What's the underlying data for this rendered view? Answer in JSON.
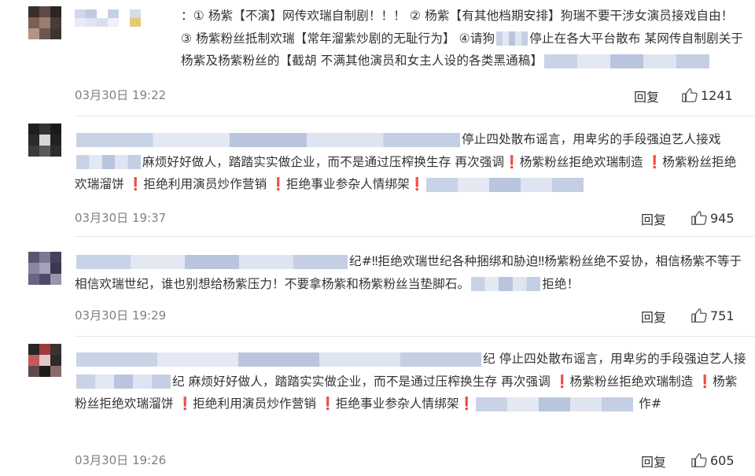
{
  "comments": [
    {
      "text_segments": [
        "：① 杨紫【不演】网传欢瑞自制剧！！！ ② 杨紫【有其他档期安排】狗瑞不要干涉女演员接戏自由！ ③ 杨紫粉丝抵制欢瑞【常年溜紫炒剧的无耻行为】 ④请狗",
        "停止在各大平台散布 某网传自制剧关于杨紫及杨紫粉丝的【截胡 不满其他演员和女主人设的各类黑通稿】"
      ],
      "date": "03月30日 19:22",
      "reply_label": "回复",
      "likes": "1241"
    },
    {
      "text_segments": [
        "停止四处散布谣言，用卑劣的手段强迫艺人接戏",
        "麻烦好好做人，踏踏实实做企业，而不是通过压榨换生存 再次强调",
        "杨紫粉丝拒绝欢瑞制造",
        "杨紫粉丝拒绝欢瑞溜饼",
        "拒绝利用演员炒作营销",
        "拒绝事业参杂人情绑架"
      ],
      "exclamation": "❗",
      "date": "03月30日 19:37",
      "reply_label": "回复",
      "likes": "945"
    },
    {
      "text_segments": [
        "纪#‼拒绝欢瑞世纪各种捆绑和胁迫‼杨紫粉丝绝不妥协，相信杨紫不等于相信欢瑞世纪，谁也别想给杨紫压力！不要拿杨紫和杨紫粉丝当垫脚石。",
        "拒绝！"
      ],
      "date": "03月30日 19:29",
      "reply_label": "回复",
      "likes": "751"
    },
    {
      "text_segments": [
        "纪 停止四处散布谣言，用卑劣的手段强迫艺人接",
        "纪 麻烦好好做人，踏踏实实做企业，而不是通过压榨换生存 再次强调",
        "杨紫粉丝拒绝欢瑞制造",
        "杨紫粉丝拒绝欢瑞溜饼",
        "拒绝利用演员炒作营销",
        "拒绝事业参杂人情绑架",
        "作#"
      ],
      "exclamation": "❗",
      "date": "03月30日 19:26",
      "reply_label": "回复",
      "likes": "605"
    }
  ],
  "icons": {
    "like": "thumbs-up-icon"
  },
  "colors": {
    "text": "#333333",
    "meta": "#808080",
    "exclamation": "#e0201b",
    "divider": "#e8e8e8"
  }
}
